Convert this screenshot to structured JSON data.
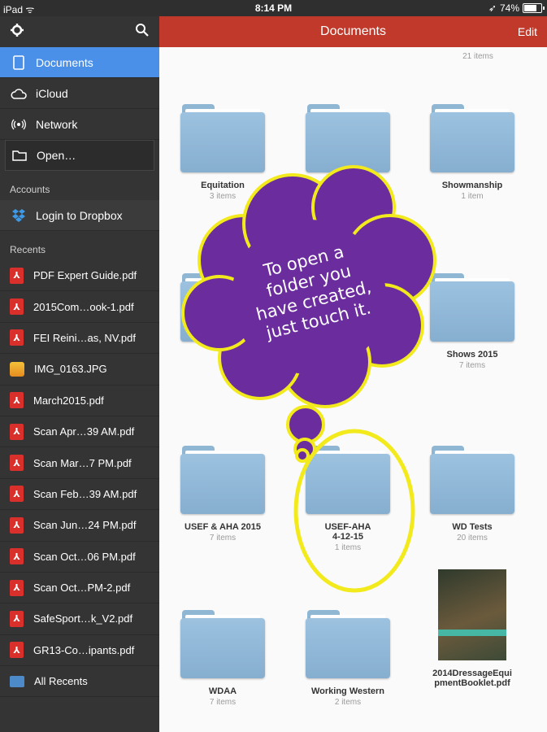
{
  "status": {
    "left": "iPad ᯤ",
    "time": "8:14 PM",
    "battery": "74%",
    "battery_fraction": 0.74
  },
  "sidebar": {
    "main_items": [
      {
        "label": "Documents",
        "icon": "document-icon"
      },
      {
        "label": "iCloud",
        "icon": "cloud-icon"
      },
      {
        "label": "Network",
        "icon": "network-icon"
      },
      {
        "label": "Open…",
        "icon": "folder-icon"
      }
    ],
    "accounts_header": "Accounts",
    "dropbox_label": "Login to Dropbox",
    "recents_header": "Recents",
    "recents": [
      {
        "label": "PDF Expert Guide.pdf",
        "type": "pdf"
      },
      {
        "label": "2015Com…ook-1.pdf",
        "type": "pdf"
      },
      {
        "label": "FEI Reini…as, NV.pdf",
        "type": "pdf"
      },
      {
        "label": "IMG_0163.JPG",
        "type": "image"
      },
      {
        "label": "March2015.pdf",
        "type": "pdf"
      },
      {
        "label": "Scan Apr…39 AM.pdf",
        "type": "pdf"
      },
      {
        "label": "Scan Mar…7 PM.pdf",
        "type": "pdf"
      },
      {
        "label": "Scan Feb…39 AM.pdf",
        "type": "pdf"
      },
      {
        "label": "Scan Jun…24 PM.pdf",
        "type": "pdf"
      },
      {
        "label": "Scan Oct…06 PM.pdf",
        "type": "pdf"
      },
      {
        "label": "Scan Oct…PM-2.pdf",
        "type": "pdf"
      },
      {
        "label": "SafeSport…k_V2.pdf",
        "type": "pdf"
      },
      {
        "label": "GR13-Co…ipants.pdf",
        "type": "pdf"
      }
    ],
    "all_recents": "All Recents"
  },
  "navbar": {
    "title": "Documents",
    "edit": "Edit"
  },
  "content": {
    "top_count": "21 items",
    "tiles": [
      {
        "name": "Equitation",
        "count": "3 items"
      },
      {
        "name": "",
        "count": ""
      },
      {
        "name": "Showmanship",
        "count": "1 item"
      },
      {
        "name": "",
        "count": ""
      },
      {
        "name": "",
        "count": ""
      },
      {
        "name": "Shows 2015",
        "count": "7 items"
      },
      {
        "name": "USEF & AHA 2015",
        "count": "7 items"
      },
      {
        "name": "USEF-AHA\n4-12-15",
        "count": "1 items"
      },
      {
        "name": "WD Tests",
        "count": "20 items"
      },
      {
        "name": "WDAA",
        "count": "7 items"
      },
      {
        "name": "Working Western",
        "count": "2 items"
      },
      {
        "name": "2014DressageEqui\npmentBooklet.pdf",
        "count": ""
      }
    ]
  },
  "annotation": {
    "lines": [
      "To open a",
      "folder you",
      "have created,",
      "just touch it."
    ],
    "cloud_color": "#6b2d9e",
    "outline_color": "#f2ea1c"
  }
}
